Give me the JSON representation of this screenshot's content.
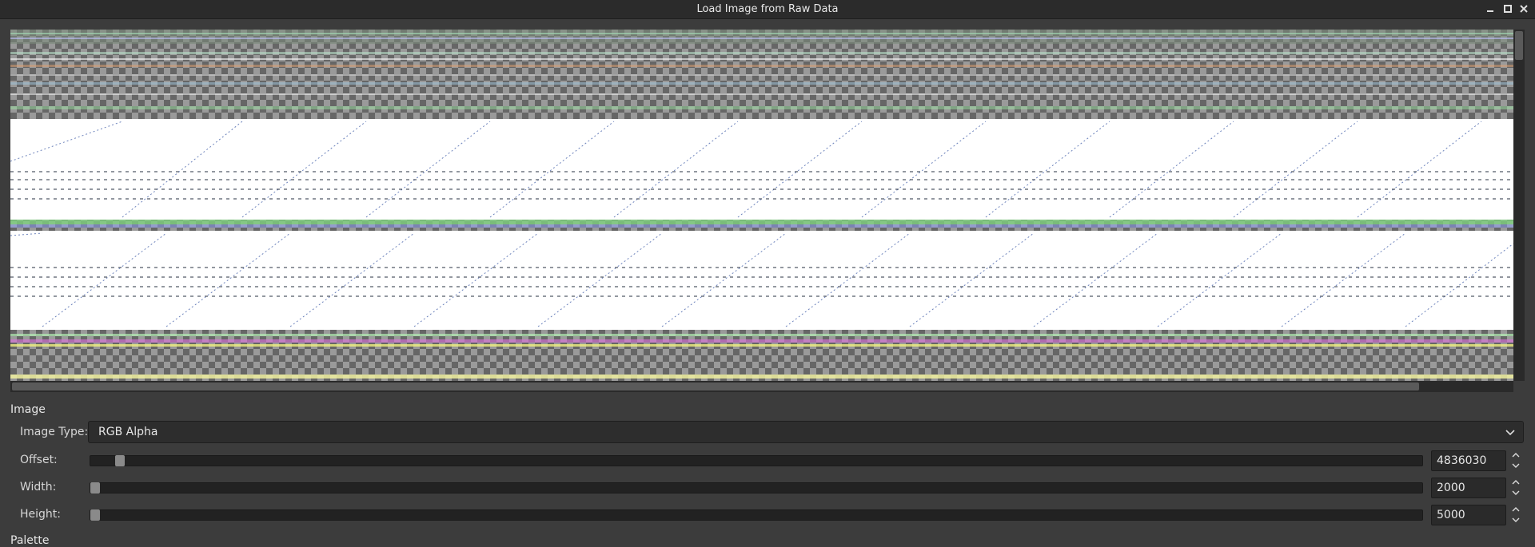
{
  "window": {
    "title": "Load Image from Raw Data",
    "minimize_icon": "minimize-icon",
    "maximize_icon": "maximize-icon",
    "close_icon": "close-icon"
  },
  "preview": {
    "description_icon": "raw-image-preview"
  },
  "image_section": {
    "heading": "Image",
    "image_type": {
      "label": "Image Type:",
      "value": "RGB Alpha"
    },
    "offset": {
      "label": "Offset:",
      "value": "4836030",
      "fraction": 0.019
    },
    "width": {
      "label": "Width:",
      "value": "2000",
      "fraction": 0.0
    },
    "height": {
      "label": "Height:",
      "value": "5000",
      "fraction": 0.0
    }
  },
  "next_section": {
    "heading": "Palette"
  }
}
